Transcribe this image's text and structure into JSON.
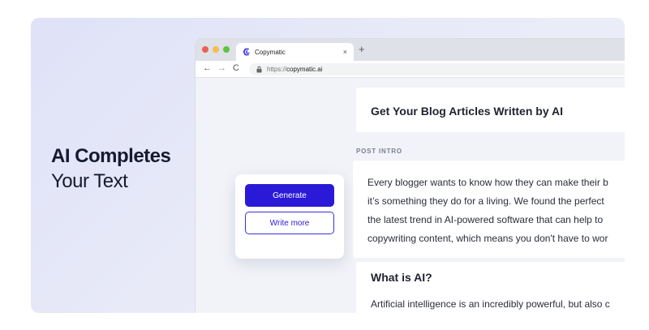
{
  "headline": {
    "line1": "AI Completes",
    "line2": "Your Text"
  },
  "browser": {
    "tab_title": "Copymatic",
    "tab_close": "×",
    "new_tab": "+",
    "nav_back": "←",
    "nav_forward": "→",
    "nav_reload": "C",
    "url_scheme": "https://",
    "url_host": "copymatic.ai"
  },
  "page": {
    "article_title": "Get Your Blog Articles Written by AI",
    "section_label": "POST INTRO",
    "intro_lines": [
      "Every blogger wants to know how they can make their b",
      "it’s something they do for a living. We found the perfect",
      "the latest trend in AI-powered software that can help to",
      "copywriting content, which means you don't have to wor"
    ],
    "question_heading": "What is AI?",
    "question_body": "Artificial intelligence is an incredibly powerful, but also c"
  },
  "actions": {
    "generate_label": "Generate",
    "write_more_label": "Write more"
  },
  "colors": {
    "accent": "#2a1ad8",
    "favicon": "#4b3fe0"
  }
}
